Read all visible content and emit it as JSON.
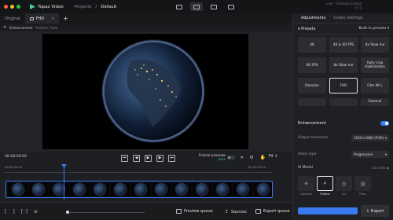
{
  "app": {
    "name": "Topaz Video",
    "user_line1": "user · Floating License",
    "user_line2": "v1.0"
  },
  "breadcrumb": [
    "Projects",
    "/",
    "Default"
  ],
  "tabs": [
    {
      "label": "Original"
    },
    {
      "label": "FHD",
      "close": "✕"
    }
  ],
  "tab_add": "+",
  "info": {
    "title": "Enhancement",
    "detail": "Proteus, Auto"
  },
  "panel": {
    "tabs": [
      "Adjustments",
      "Codec settings"
    ],
    "presets_title": "Presets",
    "presets_filter": "Built-in presets ▾",
    "presets": [
      "4K",
      "4K & 60 FPS",
      "4x Slow mo",
      "60 FPS",
      "8x Slow mo",
      "Auto crop stabilization",
      "Denoise",
      "FHD",
      "Film 4K L",
      "",
      "",
      "General"
    ],
    "enhancement_label": "Enhancement",
    "output_resolution_label": "Output resolution",
    "output_resolution_value": "1920×1080 (FHD)",
    "video_type_label": "Video type",
    "video_type_value": "Progressive",
    "ai_model_label": "AI Model",
    "list_view": "List view ◉",
    "models": [
      {
        "label": "Upscaled",
        "icon": "✳"
      },
      {
        "label": "Proteus",
        "icon": "⌕"
      },
      {
        "label": "Iris",
        "icon": "◎"
      },
      {
        "label": "Rhea",
        "icon": "◍"
      }
    ],
    "export_label": "Export"
  },
  "timeline": {
    "timecode": "00:00:06:00",
    "frame_preview": "Frame preview",
    "beta": "BETA",
    "fit": "Fit ↕",
    "ruler": [
      "00:00:00:00",
      "00:00:05:00"
    ]
  },
  "bottom": {
    "preview_queue": "Preview queue",
    "sources": "Sources",
    "export_queue": "Export queue"
  },
  "colors": {
    "accent": "#3a7bf0",
    "brand": "#3ecf8e",
    "background": "#1e1f22"
  }
}
